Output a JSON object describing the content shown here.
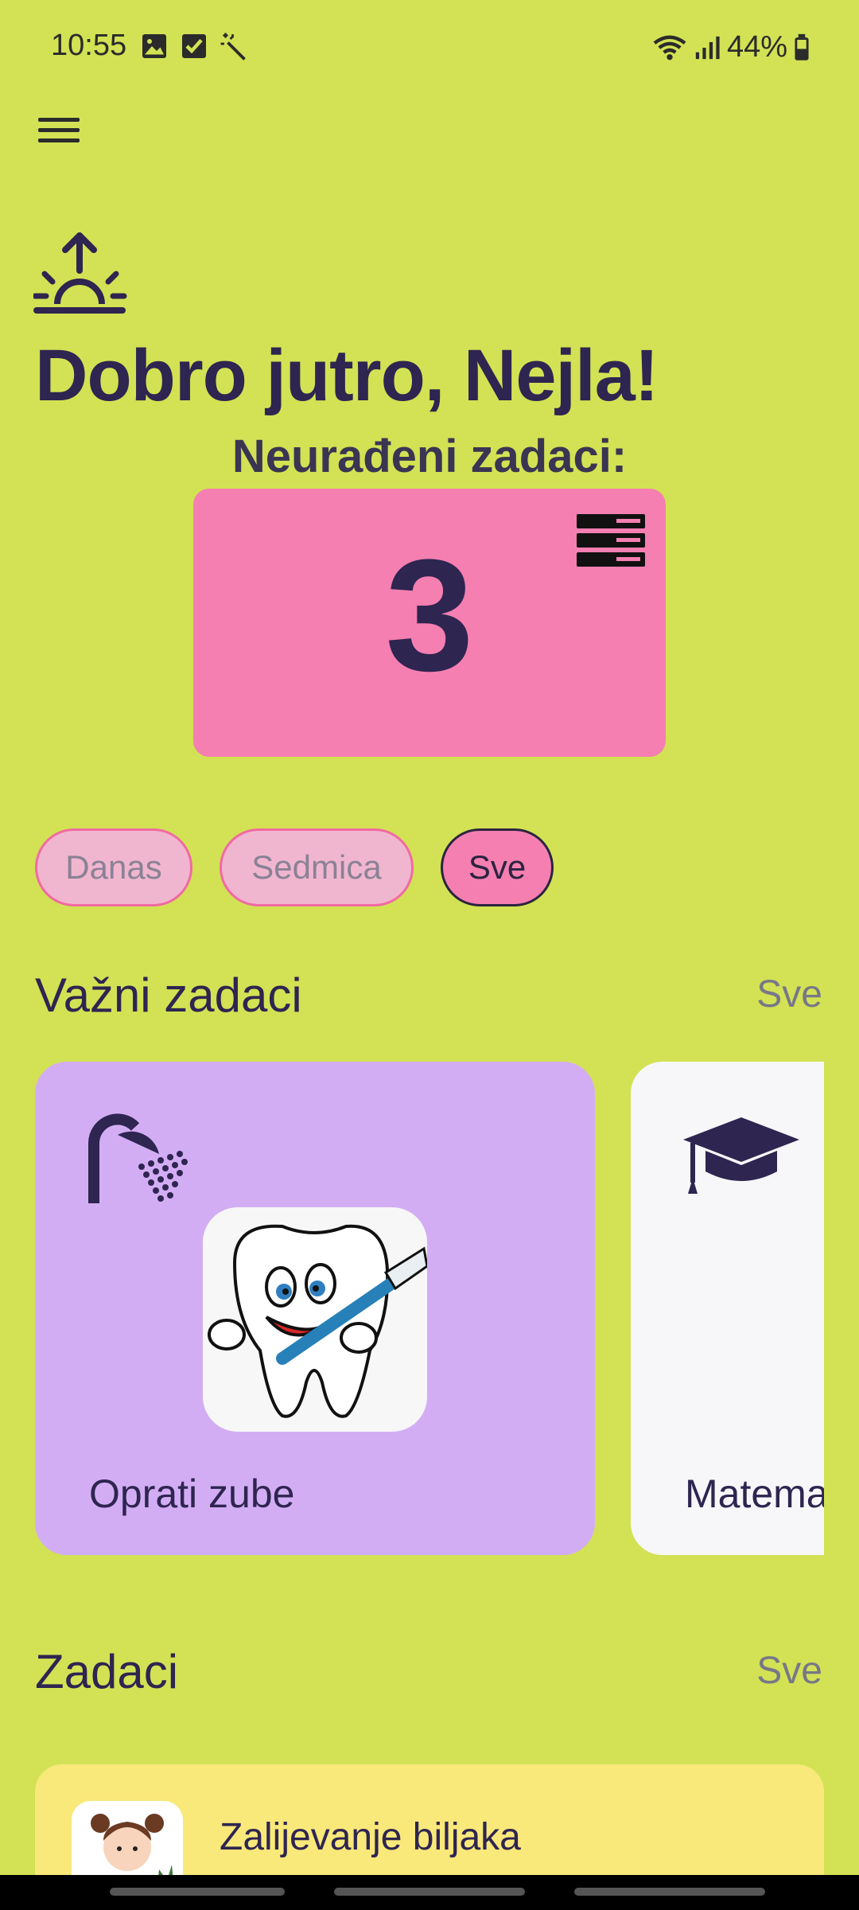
{
  "status": {
    "time": "10:55",
    "battery": "44%"
  },
  "icons": {
    "menu": "hamburger-menu-icon",
    "sunrise": "sunrise-icon",
    "list": "task-list-icon",
    "shower": "shower-icon",
    "graduation": "graduation-cap-icon"
  },
  "header": {
    "greeting": "Dobro jutro, Nejla!",
    "pending_label": "Neurađeni zadaci:",
    "pending_count": "3"
  },
  "filters": [
    {
      "label": "Danas",
      "active": false
    },
    {
      "label": "Sedmica",
      "active": false
    },
    {
      "label": "Sve",
      "active": true
    }
  ],
  "important": {
    "title": "Važni zadaci",
    "see_all": "Sve",
    "cards": [
      {
        "label": "Oprati zube",
        "icon": "shower-icon"
      },
      {
        "label": "Matema",
        "icon": "graduation-cap-icon"
      }
    ]
  },
  "tasks": {
    "title": "Zadaci",
    "see_all": "Sve",
    "items": [
      {
        "label": "Zalijevanje biljaka"
      }
    ]
  },
  "colors": {
    "background": "#d2e254",
    "accent_pink": "#f57fb1",
    "card_purple": "#d3adf4",
    "card_yellow": "#f9e87a",
    "text_dark": "#2e2550"
  }
}
